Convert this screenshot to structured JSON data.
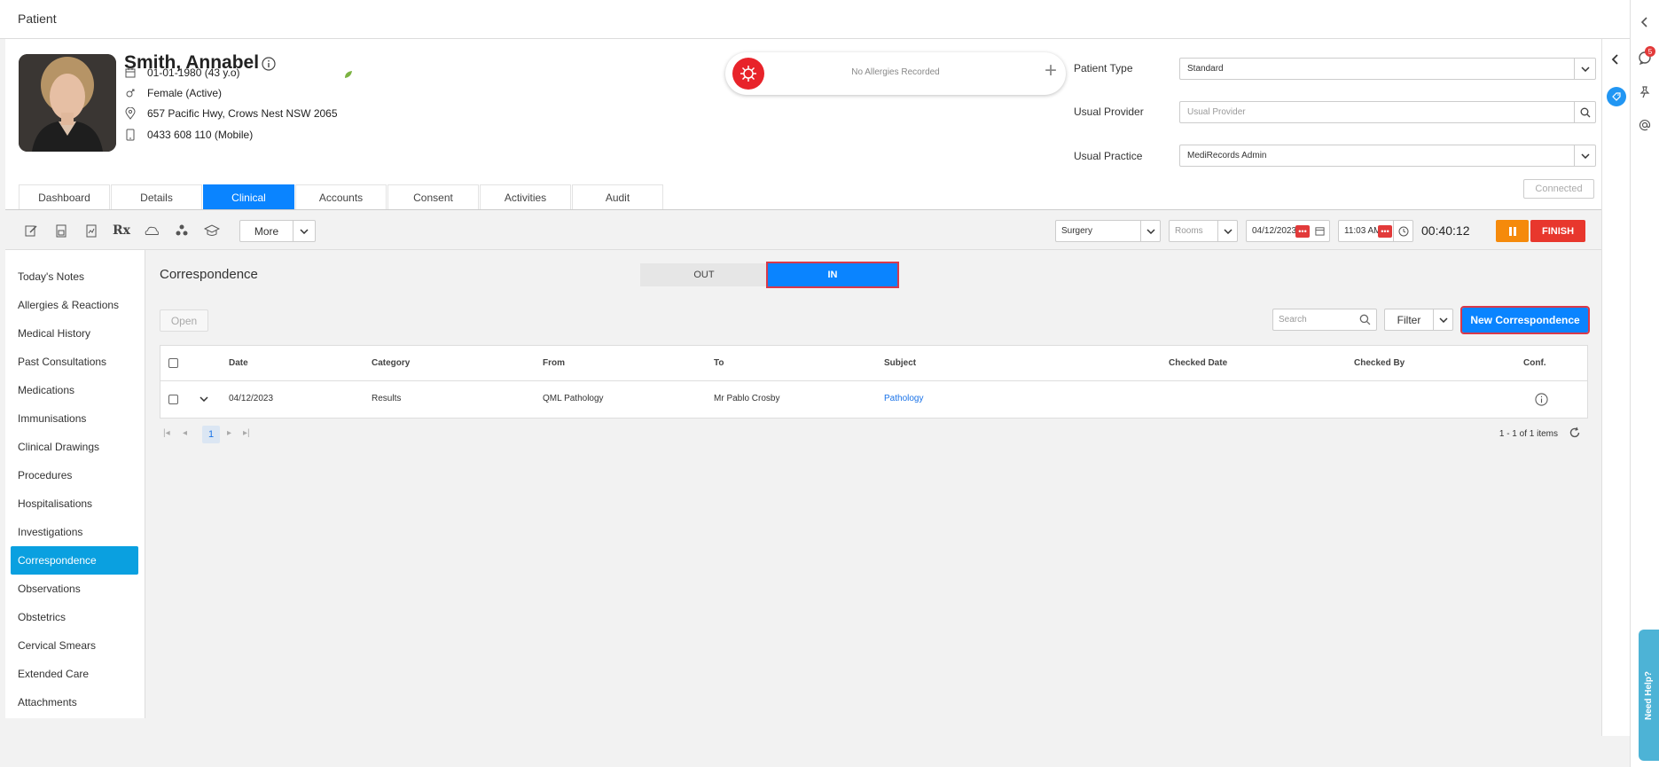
{
  "topbar": {
    "title": "Patient"
  },
  "patient": {
    "name": "Smith, Annabel",
    "dob": "01-01-1980 (43 y.o)",
    "gender": "Female (Active)",
    "address": "657 Pacific Hwy, Crows Nest NSW 2065",
    "phone": "0433 608 110 (Mobile)"
  },
  "allergies": {
    "text": "No Allergies Recorded"
  },
  "fields": {
    "patient_type_label": "Patient Type",
    "patient_type_value": "Standard",
    "usual_provider_label": "Usual Provider",
    "usual_provider_placeholder": "Usual Provider",
    "usual_practice_label": "Usual Practice",
    "usual_practice_value": "MediRecords Admin"
  },
  "connected": "Connected",
  "tabs": [
    "Dashboard",
    "Details",
    "Clinical",
    "Accounts",
    "Consent",
    "Activities",
    "Audit"
  ],
  "active_tab": "Clinical",
  "toolbar": {
    "more": "More",
    "surgery": "Surgery",
    "rooms": "Rooms",
    "date": "04/12/2023",
    "time": "11:03 AM",
    "timer": "00:40:12",
    "finish": "FINISH"
  },
  "nav": [
    "Today's Notes",
    "Allergies & Reactions",
    "Medical History",
    "Past Consultations",
    "Medications",
    "Immunisations",
    "Clinical Drawings",
    "Procedures",
    "Hospitalisations",
    "Investigations",
    "Correspondence",
    "Observations",
    "Obstetrics",
    "Cervical Smears",
    "Extended Care",
    "Attachments"
  ],
  "active_nav": "Correspondence",
  "main": {
    "title": "Correspondence",
    "toggle_out": "OUT",
    "toggle_in": "IN",
    "open": "Open",
    "search_placeholder": "Search",
    "filter": "Filter",
    "new_correspondence": "New Correspondence",
    "columns": [
      "Date",
      "Category",
      "From",
      "To",
      "Subject",
      "Checked Date",
      "Checked By",
      "Conf."
    ],
    "rows": [
      {
        "date": "04/12/2023",
        "category": "Results",
        "from": "QML Pathology",
        "to": "Mr Pablo Crosby",
        "subject": "Pathology",
        "checked_date": "",
        "checked_by": ""
      }
    ],
    "page": "1",
    "page_info": "1 - 1 of 1 items"
  },
  "notifications_count": "5",
  "need_help": "Need Help?",
  "colors": {
    "accent": "#0a84ff",
    "nav_active": "#0aa0e0",
    "finish": "#e8372d",
    "pause": "#f58a0b",
    "highlight_outline": "#d9394a"
  }
}
